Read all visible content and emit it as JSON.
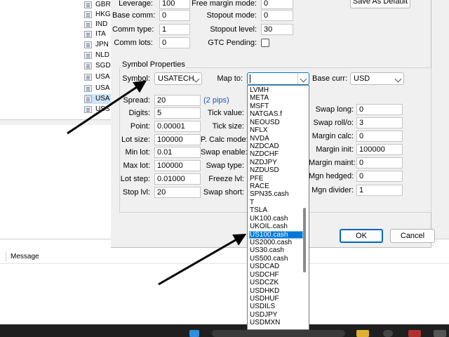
{
  "symbol_list": {
    "items": [
      "GBR",
      "HKG",
      "IND",
      "ITA",
      "JPN",
      "NLD",
      "SGD",
      "USA",
      "USA",
      "USA",
      "USS"
    ],
    "selected_index": 9
  },
  "log": {
    "message_header": "Message"
  },
  "dialog": {
    "save_default_label": "Save As Default",
    "top_fields": {
      "leverage_label": "Leverage:",
      "leverage_value": "100",
      "base_comm_label": "Base comm:",
      "base_comm_value": "0",
      "comm_type_label": "Comm type:",
      "comm_type_value": "1",
      "comm_lots_label": "Comm lots:",
      "comm_lots_value": "0",
      "free_margin_label": "Free margin mode:",
      "free_margin_value": "0",
      "stopout_mode_label": "Stopout mode:",
      "stopout_mode_value": "0",
      "stopout_level_label": "Stopout level:",
      "stopout_level_value": "30",
      "gtc_label": "GTC Pending:",
      "gtc_checked": false
    },
    "symbol_properties": {
      "group_title": "Symbol Properties",
      "symbol_label": "Symbol:",
      "symbol_value": "USATECH",
      "map_to_label": "Map to:",
      "map_to_value": "",
      "base_curr_label": "Base curr:",
      "base_curr_value": "USD",
      "spread_label": "Spread:",
      "spread_value": "20",
      "spread_pips": "(2 pips)",
      "digits_label": "Digits:",
      "digits_value": "5",
      "point_label": "Point:",
      "point_value": "0.00001",
      "lot_size_label": "Lot size:",
      "lot_size_value": "100000",
      "min_lot_label": "Min lot:",
      "min_lot_value": "0.01",
      "max_lot_label": "Max lot:",
      "max_lot_value": "100000",
      "lot_step_label": "Lot step:",
      "lot_step_value": "0.01000",
      "stop_lvl_label": "Stop lvl:",
      "stop_lvl_value": "20",
      "tick_value_label": "Tick value:",
      "tick_size_label": "Tick size:",
      "p_calc_mode_label": "P. Calc mode:",
      "swap_enable_label": "Swap enable:",
      "swap_type_label": "Swap type:",
      "freeze_lvl_label": "Freeze lvl:",
      "swap_short_label": "Swap short:",
      "swap_long_label": "Swap long:",
      "swap_long_value": "0",
      "swap_roll_label": "Swap roll/o:",
      "swap_roll_value": "3",
      "margin_calc_label": "Margin calc:",
      "margin_calc_value": "0",
      "margin_init_label": "Margin init:",
      "margin_init_value": "100000",
      "margin_maint_label": "Margin maint:",
      "margin_maint_value": "0",
      "mgn_hedged_label": "Mgn hedged:",
      "mgn_hedged_value": "0",
      "mgn_divider_label": "Mgn divider:",
      "mgn_divider_value": "1"
    },
    "buttons": {
      "ok": "OK",
      "cancel": "Cancel"
    }
  },
  "map_to_dropdown": {
    "items": [
      "LVMH",
      "META",
      "MSFT",
      "NATGAS.f",
      "NEOUSD",
      "NFLX",
      "NVDA",
      "NZDCAD",
      "NZDCHF",
      "NZDJPY",
      "NZDUSD",
      "PFE",
      "RACE",
      "SPN35.cash",
      "T",
      "TSLA",
      "UK100.cash",
      "UKOIL.cash",
      "US100.cash",
      "US2000.cash",
      "US30.cash",
      "US500.cash",
      "USDCAD",
      "USDCHF",
      "USDCZK",
      "USDHKD",
      "USDHUF",
      "USDILS",
      "USDJPY",
      "USDMXN"
    ],
    "highlighted_index": 18,
    "highlight_color": "#0078d7"
  },
  "colors": {
    "accent": "#0078d7",
    "arrow": "#000000"
  }
}
